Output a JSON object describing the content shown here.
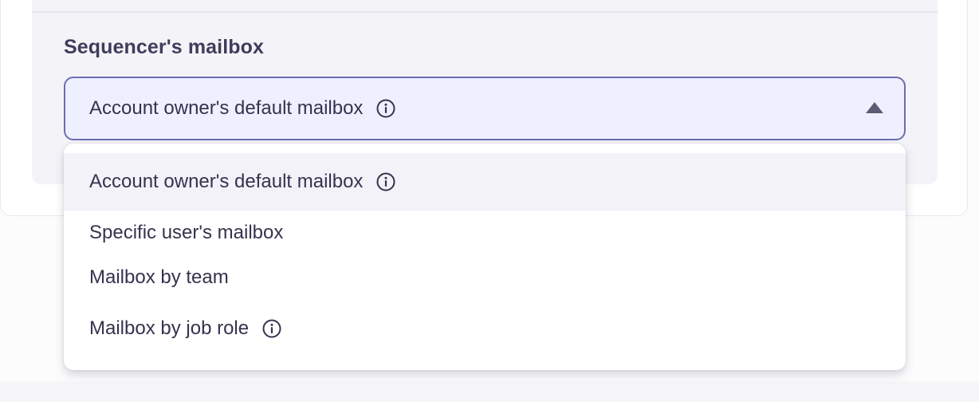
{
  "section": {
    "label": "Sequencer's mailbox"
  },
  "select": {
    "value": "Account owner's default mailbox",
    "expanded": true
  },
  "dropdown": {
    "options": [
      {
        "label": "Account owner's default mailbox",
        "has_info_icon": true,
        "selected": true
      },
      {
        "label": "Specific user's mailbox",
        "has_info_icon": false,
        "selected": false
      },
      {
        "label": "Mailbox by team",
        "has_info_icon": false,
        "selected": false
      },
      {
        "label": "Mailbox by job role",
        "has_info_icon": true,
        "selected": false
      }
    ]
  },
  "icons": {
    "info": "info-circle-icon",
    "caret": "caret-up-icon"
  },
  "colors": {
    "select_border": "#6c6db2",
    "select_background": "#eff0ff",
    "selected_option_background": "#f2f2f8",
    "text": "#35334f"
  }
}
